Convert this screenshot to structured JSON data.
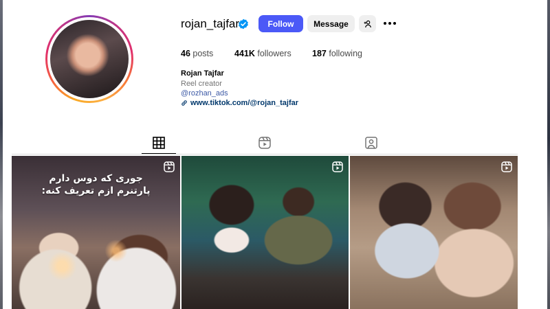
{
  "profile": {
    "username": "rojan_tajfar",
    "verified": true,
    "buttons": {
      "follow": "Follow",
      "message": "Message"
    },
    "stats": [
      {
        "value": "46",
        "label": "posts"
      },
      {
        "value": "441K",
        "label": "followers"
      },
      {
        "value": "187",
        "label": "following"
      }
    ],
    "full_name": "Rojan Tajfar",
    "category": "Reel creator",
    "mention": "@rozhan_ads",
    "link": "www.tiktok.com/@rojan_tajfar"
  },
  "tabs": [
    {
      "icon": "grid-icon",
      "active": true
    },
    {
      "icon": "reels-icon",
      "active": false
    },
    {
      "icon": "tagged-icon",
      "active": false
    }
  ],
  "posts": [
    {
      "type": "reel",
      "caption": "جوری که دوس دارم پارتنرم ازم تعریف کنه:"
    },
    {
      "type": "reel",
      "caption": ""
    },
    {
      "type": "reel",
      "caption": ""
    }
  ],
  "colors": {
    "follow_button": "#4b59f7",
    "secondary_button": "#efefef",
    "link": "#00376b",
    "mention": "#3b58a5",
    "verified_badge": "#0095f6"
  }
}
